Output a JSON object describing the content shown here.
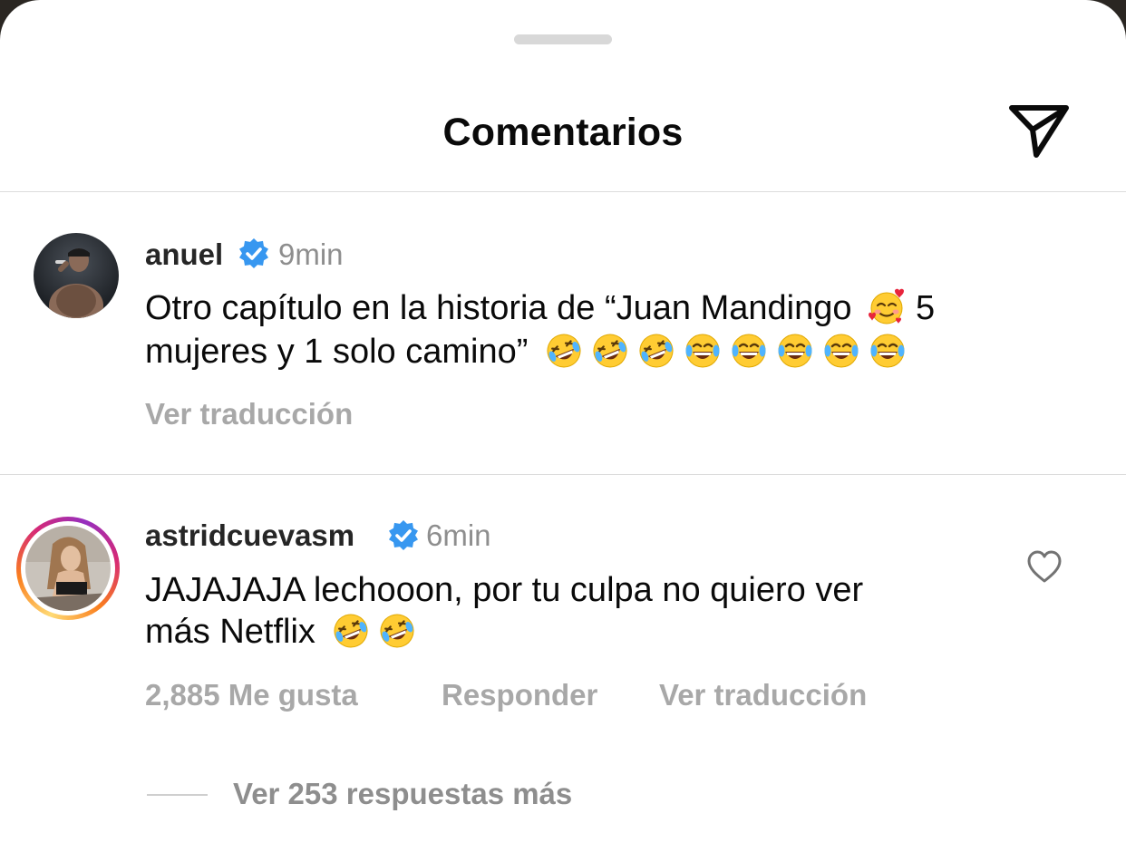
{
  "header": {
    "title": "Comentarios"
  },
  "comments": [
    {
      "username": "anuel",
      "verified": true,
      "time": "9min",
      "text_line1": "Otro capítulo en la historia de “Juan Mandingo",
      "text_line1_end": "5",
      "text_line2": "mujeres y 1 solo camino”",
      "emojis_line1": [
        "smiling-face-with-hearts"
      ],
      "emojis_line2": [
        "rofl",
        "rofl",
        "rofl",
        "joy",
        "joy",
        "joy",
        "joy",
        "joy"
      ],
      "translate_label": "Ver traducción"
    },
    {
      "username": "astridcuevasm",
      "verified": true,
      "time": "6min",
      "text_line1": "JAJAJAJA lechooon, por tu culpa no quiero ver",
      "text_line2": "más Netflix",
      "emojis_line2": [
        "rofl",
        "rofl"
      ],
      "likes_label": "2,885 Me gusta",
      "reply_label": "Responder",
      "translate_label": "Ver traducción",
      "view_replies_label": "Ver 253 respuestas más"
    }
  ],
  "colors": {
    "verified_blue": "#3797f0",
    "muted_text": "#a8a8a8",
    "time_text": "#8e8e8e",
    "story_ring_start": "#feda75",
    "story_ring_end": "#d62976"
  }
}
